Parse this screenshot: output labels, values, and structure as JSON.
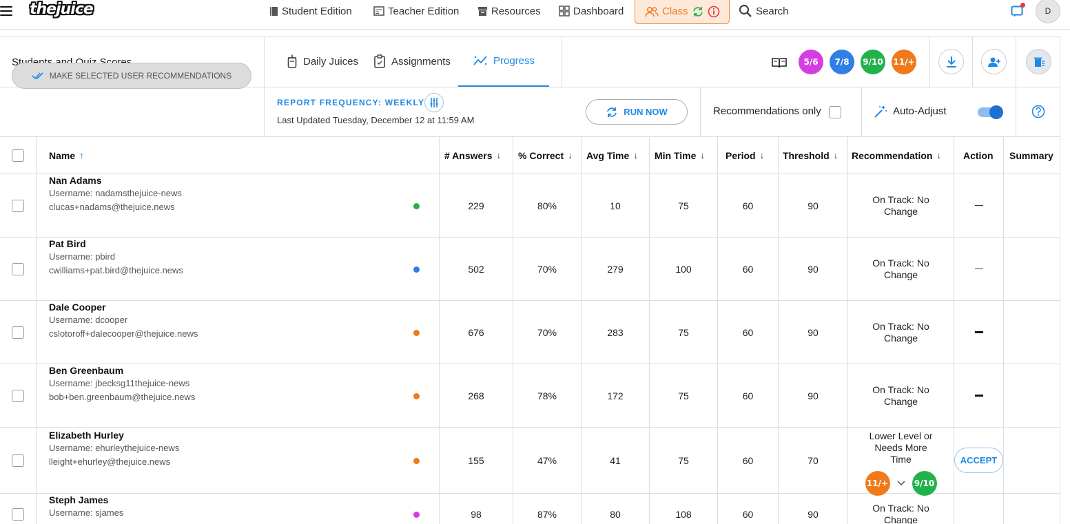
{
  "brand": {
    "logo": "thejuice"
  },
  "nav": {
    "student_edition": "Student Edition",
    "teacher_edition": "Teacher Edition",
    "resources": "Resources",
    "dashboard": "Dashboard",
    "class": "Class",
    "search": "Search",
    "avatar_initial": "D"
  },
  "panel": {
    "title": "Students and Quiz Scores",
    "tabs": [
      {
        "label": "Daily Juices",
        "icon": "cup-icon"
      },
      {
        "label": "Assignments",
        "icon": "clipboard-icon"
      },
      {
        "label": "Progress",
        "icon": "trend-icon",
        "active": true
      }
    ],
    "grades": [
      {
        "top": "5",
        "bottom": "6",
        "color": "#d63de0"
      },
      {
        "top": "7",
        "bottom": "8",
        "color": "#2f7fe6"
      },
      {
        "top": "9",
        "bottom": "10",
        "color": "#22b24c"
      },
      {
        "top": "11",
        "bottom": "+",
        "color": "#f07a1a"
      }
    ],
    "make_recommendations": "MAKE SELECTED USER RECOMMENDATIONS",
    "report_frequency": "REPORT FREQUENCY: WEEKLY",
    "last_updated": "Last Updated Tuesday, December 12 at 11:59 AM",
    "run_now": "RUN NOW",
    "recommendations_only": "Recommendations only",
    "auto_adjust": "Auto-Adjust",
    "auto_adjust_on": true
  },
  "table": {
    "headers": [
      "Name",
      "# Answers",
      "% Correct",
      "Avg Time",
      "Min Time",
      "Period",
      "Threshold",
      "Recommendation",
      "Action",
      "Summary"
    ],
    "rows": [
      {
        "name": "Nan Adams",
        "username": "Username: nadamsthejuice-news",
        "email": "clucas+nadams@thejuice.news",
        "dot": "#22b24c",
        "answers": "229",
        "correct": "80%",
        "avg": "10",
        "min": "75",
        "period": "60",
        "threshold": "90",
        "rec": "On Track: No Change"
      },
      {
        "name": "Pat Bird",
        "username": "Username: pbird",
        "email": "cwilliams+pat.bird@thejuice.news",
        "dot": "#2f7fe6",
        "answers": "502",
        "correct": "70%",
        "avg": "279",
        "min": "100",
        "period": "60",
        "threshold": "90",
        "rec": "On Track: No Change"
      },
      {
        "name": "Dale Cooper",
        "username": "Username: dcooper",
        "email": "cslotoroff+dalecooper@thejuice.news",
        "dot": "#f07a1a",
        "answers": "676",
        "correct": "70%",
        "avg": "283",
        "min": "75",
        "period": "60",
        "threshold": "90",
        "rec": "On Track: No Change"
      },
      {
        "name": "Ben Greenbaum",
        "username": "Username: jbecksg11thejuice-news",
        "email": "bob+ben.greenbaum@thejuice.news",
        "dot": "#f07a1a",
        "answers": "268",
        "correct": "78%",
        "avg": "172",
        "min": "75",
        "period": "60",
        "threshold": "90",
        "rec": "On Track: No Change"
      },
      {
        "name": "Elizabeth Hurley",
        "username": "Username: ehurleythejuice-news",
        "email": "lleight+ehurley@thejuice.news",
        "dot": "#f07a1a",
        "answers": "155",
        "correct": "47%",
        "avg": "41",
        "min": "75",
        "period": "60",
        "threshold": "70",
        "rec": "Lower Level or Needs More Time",
        "action": "ACCEPT"
      },
      {
        "name": "Steph James",
        "username": "Username: sjames",
        "email": "",
        "dot": "#d63de0",
        "answers": "98",
        "correct": "87%",
        "avg": "80",
        "min": "108",
        "period": "60",
        "threshold": "90",
        "rec": "On Track: No Change"
      }
    ]
  }
}
